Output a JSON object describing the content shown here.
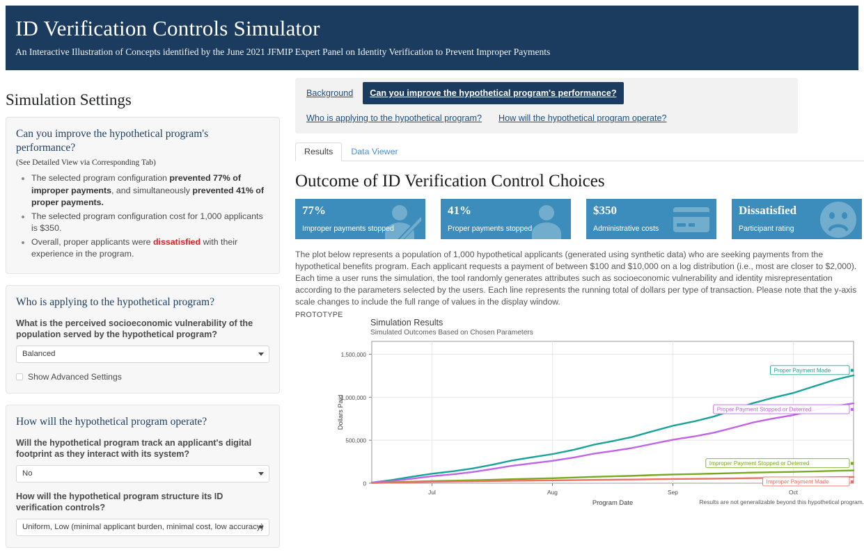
{
  "header": {
    "title": "ID Verification Controls Simulator",
    "subtitle": "An Interactive Illustration of Concepts identified by the June 2021 JFMIP Expert Panel on Identity Verification to Prevent Improper Payments"
  },
  "sidebar": {
    "title": "Simulation Settings",
    "panel1": {
      "heading": "Can you improve the hypothetical program's performance?",
      "note": "(See Detailed View via Corresponding Tab)",
      "bullet1_a": "The selected program configuration ",
      "bullet1_b": "prevented 77% of improper payments",
      "bullet1_c": ", and simultaneously ",
      "bullet1_d": "prevented 41% of proper payments.",
      "bullet2": "The selected program configuration cost for 1,000 applicants is $350.",
      "bullet3_a": "Overall, proper applicants were ",
      "bullet3_b": "dissatisfied",
      "bullet3_c": " with their experience in the program."
    },
    "panel2": {
      "heading": "Who is applying to the hypothetical program?",
      "question": "What is the perceived socioeconomic vulnerability of the population served by the hypothetical program?",
      "select_value": "Balanced",
      "checkbox_label": "Show Advanced Settings",
      "checkbox_checked": false
    },
    "panel3": {
      "heading": "How will the hypothetical program operate?",
      "question1": "Will the hypothetical program track an applicant's digital footprint as they interact with its system?",
      "select1_value": "No",
      "question2": "How will the hypothetical program structure its ID verification controls?",
      "select2_value": "Uniform, Low (minimal applicant burden, minimal cost, low accuracy)"
    }
  },
  "main": {
    "nav": [
      {
        "label": "Background",
        "active": false
      },
      {
        "label": "Can you improve the hypothetical program's performance?",
        "active": true
      },
      {
        "label": "Who is applying to the hypothetical program?",
        "active": false
      },
      {
        "label": "How will the hypothetical program operate?",
        "active": false
      }
    ],
    "subtabs": [
      {
        "label": "Results",
        "active": true
      },
      {
        "label": "Data Viewer",
        "active": false
      }
    ],
    "outcome_title": "Outcome of ID Verification Control Choices",
    "cards": [
      {
        "value": "77%",
        "label": "Improper payments stopped",
        "icon": "user-slash-icon"
      },
      {
        "value": "41%",
        "label": "Proper payments stopped",
        "icon": "user-icon"
      },
      {
        "value": "$350",
        "label": "Administrative costs",
        "icon": "credit-card-icon"
      },
      {
        "value": "Dissatisfied",
        "label": "Participant rating",
        "icon": "frown-face-icon"
      }
    ],
    "card_color": "#3c8dbc",
    "paragraph": "The plot below represents a population of 1,000 hypothetical applicants (generated using synthetic data) who are seeking payments from the hypothetical benefits program. Each applicant requests a payment of between $100 and $10,000 on a log distribution (i.e., most are closer to $2,000). Each time a user runs the simulation, the tool randomly generates attributes such as socioeconomic vulnerability and identity misrepresentation according to the parameters selected by the users. Each line represents the running total of dollars per type of transaction. Please note that the y-axis scale changes to include the full range of values in the display window.",
    "prototype_tag": "PROTOTYPE",
    "footnote": "Results are not generalizable beyond this hypothetical program."
  },
  "chart_data": {
    "type": "line",
    "title": "Simulation Results",
    "subtitle": "Simulated Outcomes Based on Chosen Parameters",
    "xlabel": "Program Date",
    "ylabel": "Dollars Paid",
    "xticks": [
      "Jul",
      "Aug",
      "Sep",
      "Oct"
    ],
    "yticks": [
      "0",
      "500,000",
      "1,000,000",
      "1,500,000"
    ],
    "ylim": [
      0,
      1650000
    ],
    "grid": true,
    "legend_position": "inline-right-labels",
    "x": [
      0,
      0.08,
      0.17,
      0.25,
      0.33,
      0.42,
      0.5,
      0.58,
      0.67,
      0.75,
      0.83,
      0.92,
      1.0
    ],
    "series": [
      {
        "name": "Proper Payment Made",
        "color": "#17a398",
        "values": [
          8000,
          72000,
          140000,
          215000,
          300000,
          390000,
          490000,
          600000,
          720000,
          850000,
          990000,
          1130000,
          1255000
        ]
      },
      {
        "name": "Proper Payment Stopped or Deterred",
        "color": "#c163e8",
        "values": [
          6000,
          50000,
          105000,
          165000,
          230000,
          300000,
          375000,
          455000,
          545000,
          645000,
          750000,
          850000,
          930000
        ]
      },
      {
        "name": "Improper Payment Stopped or Deterred",
        "color": "#76a91c",
        "values": [
          4000,
          18000,
          30000,
          40000,
          52000,
          66000,
          80000,
          94000,
          107000,
          118000,
          128000,
          138000,
          148000
        ]
      },
      {
        "name": "Improper Payment Made",
        "color": "#ef6f63",
        "values": [
          3000,
          12000,
          20000,
          26000,
          31000,
          36000,
          41000,
          46000,
          51000,
          56000,
          62000,
          68000,
          73000
        ]
      }
    ]
  }
}
